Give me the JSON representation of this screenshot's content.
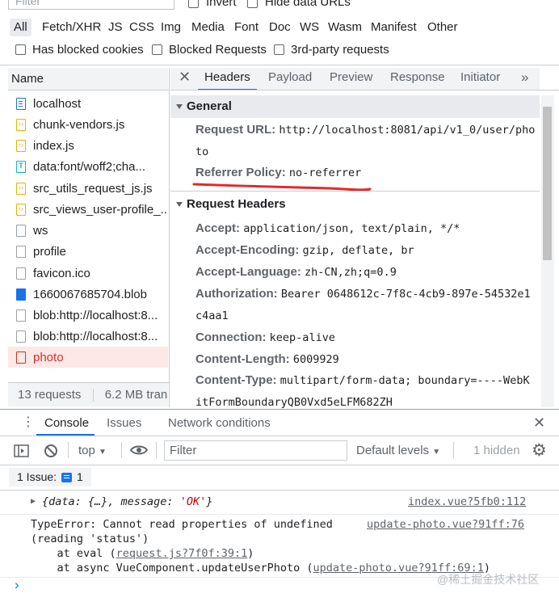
{
  "filter_bar": {
    "placeholder": "Filter",
    "invert_label": "Invert",
    "hide_data_urls_label": "Hide data URLs"
  },
  "type_filters": [
    "All",
    "Fetch/XHR",
    "JS",
    "CSS",
    "Img",
    "Media",
    "Font",
    "Doc",
    "WS",
    "Wasm",
    "Manifest",
    "Other"
  ],
  "options": {
    "blocked_cookies": "Has blocked cookies",
    "blocked_requests": "Blocked Requests",
    "third_party": "3rd-party requests"
  },
  "name_column": {
    "header": "Name",
    "requests": [
      {
        "name": "localhost",
        "icon": "document-icon"
      },
      {
        "name": "chunk-vendors.js",
        "icon": "script-icon"
      },
      {
        "name": "index.js",
        "icon": "script-icon"
      },
      {
        "name": "data:font/woff2;cha...",
        "icon": "font-icon"
      },
      {
        "name": "src_utils_request_js.js",
        "icon": "script-icon"
      },
      {
        "name": "src_views_user-profile_...",
        "icon": "script-icon"
      },
      {
        "name": "ws",
        "icon": "file-icon"
      },
      {
        "name": "profile",
        "icon": "file-icon"
      },
      {
        "name": "favicon.ico",
        "icon": "file-icon"
      },
      {
        "name": "1660067685704.blob",
        "icon": "image-icon"
      },
      {
        "name": "blob:http://localhost:8...",
        "icon": "file-icon"
      },
      {
        "name": "blob:http://localhost:8...",
        "icon": "file-icon"
      },
      {
        "name": "photo",
        "icon": "error-file-icon"
      }
    ],
    "status": {
      "requests": "13 requests",
      "transferred": "6.2 MB trans"
    }
  },
  "detail_tabs": [
    "Headers",
    "Payload",
    "Preview",
    "Response",
    "Initiator"
  ],
  "general": {
    "title": "General",
    "request_url_key": "Request URL:",
    "request_url_value_1": "http://localhost:8081/api/v1_0/user/pho",
    "request_url_value_2": "to",
    "referrer_key": "Referrer Policy:",
    "referrer_value": "no-referrer"
  },
  "request_headers": {
    "title": "Request Headers",
    "rows": [
      {
        "k": "Accept:",
        "v": "application/json, text/plain, */*"
      },
      {
        "k": "Accept-Encoding:",
        "v": "gzip, deflate, br"
      },
      {
        "k": "Accept-Language:",
        "v": "zh-CN,zh;q=0.9"
      },
      {
        "k": "Authorization:",
        "v": "Bearer 0648612c-7f8c-4cb9-897e-54532e1"
      },
      {
        "k": "",
        "v": "c4aa1"
      },
      {
        "k": "Connection:",
        "v": "keep-alive"
      },
      {
        "k": "Content-Length:",
        "v": "6009929"
      },
      {
        "k": "Content-Type:",
        "v": "multipart/form-data; boundary=----WebK"
      },
      {
        "k": "",
        "v": "itFormBoundaryQB0Vxd5eLFM682ZH"
      }
    ]
  },
  "console": {
    "tabs": [
      "Console",
      "Issues",
      "Network conditions"
    ],
    "context": "top",
    "filter_placeholder": "Filter",
    "levels": "Default levels",
    "hidden": "1 hidden",
    "issues_label": "1 Issue:",
    "issues_count": "1",
    "messages": {
      "log_prefix": "{data: {…}, message: ",
      "log_ok": "'OK'",
      "log_suffix": "}",
      "log_source": "index.vue?5fb0:112",
      "error_line1": "TypeError: Cannot read properties of undefined",
      "error_line2": "(reading 'status')",
      "error_source": "update-photo.vue?91ff:76",
      "stack1_prefix": "    at eval (",
      "stack1_link": "request.js?7f0f:39:1",
      "stack1_suffix": ")",
      "stack2_prefix": "    at async VueComponent.updateUserPhoto (",
      "stack2_link": "update-photo.vue?91ff:69:1",
      "stack2_suffix": ")"
    },
    "prompt": "›"
  },
  "watermark": "@稀土掘金技术社区",
  "colors": {
    "accent": "#1a73e8",
    "error": "#d93025",
    "annotation": "#e8262a"
  }
}
